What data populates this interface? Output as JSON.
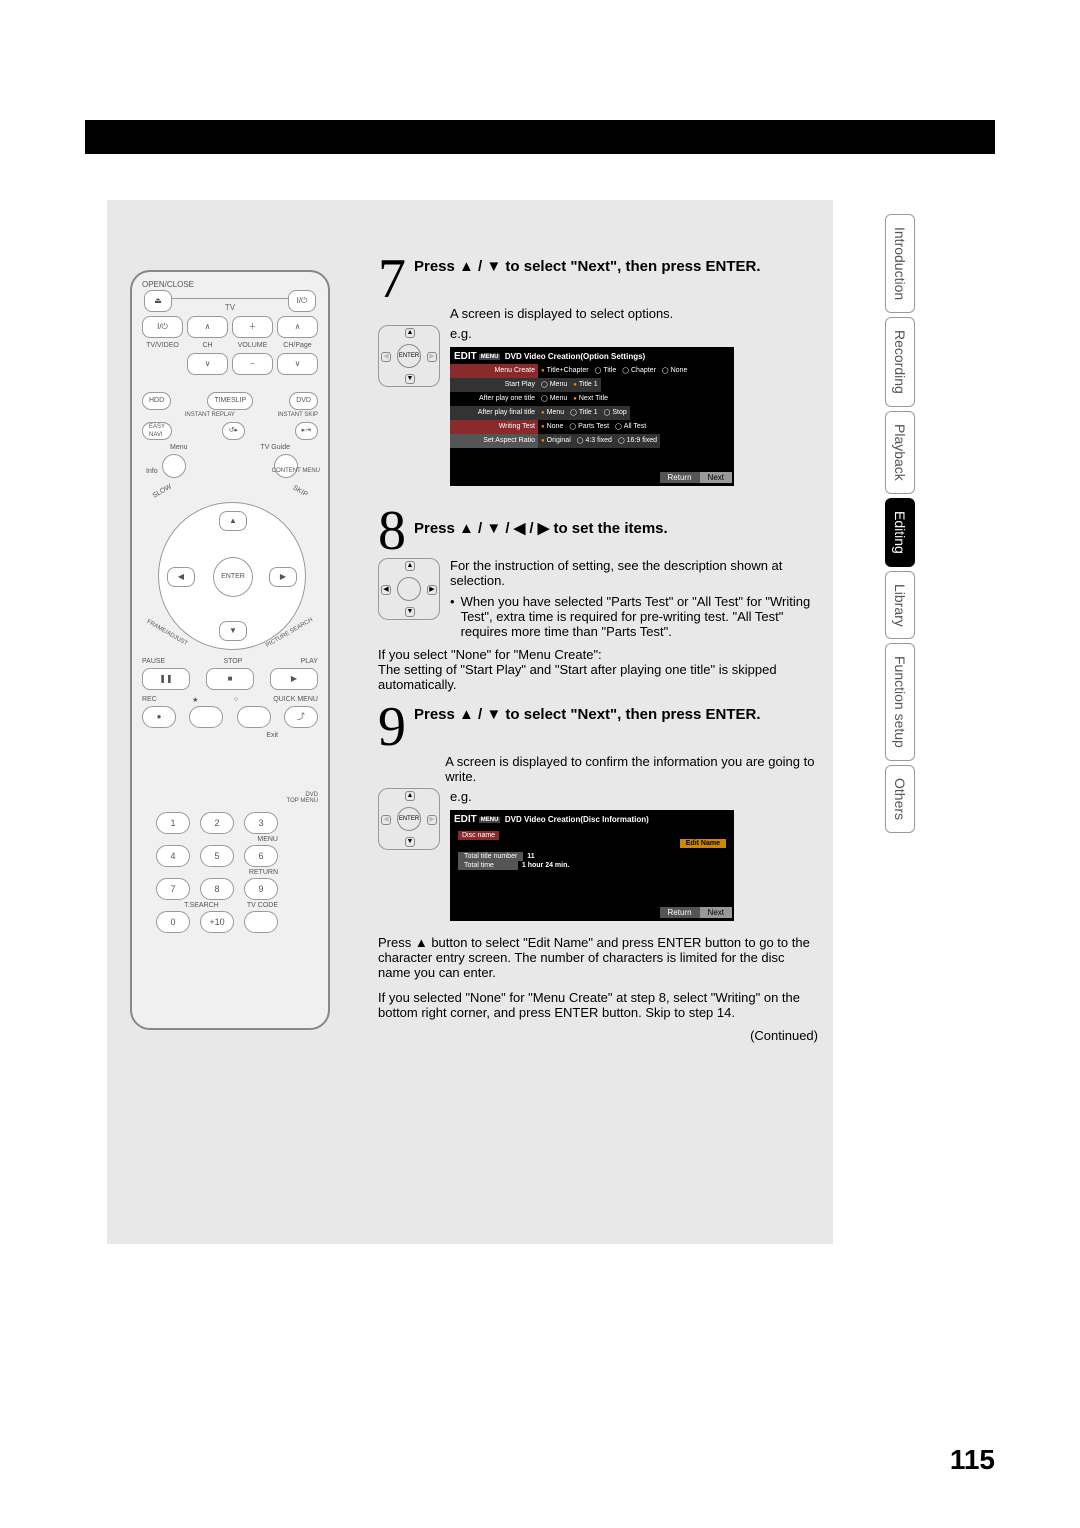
{
  "page_number": "115",
  "continued": "(Continued)",
  "tabs": [
    "Introduction",
    "Recording",
    "Playback",
    "Editing",
    "Library",
    "Function setup",
    "Others"
  ],
  "active_tab": "Editing",
  "remote": {
    "open_close": "OPEN/CLOSE",
    "tv": "TV",
    "tvvideo": "TV/VIDEO",
    "ch": "CH",
    "volume": "VOLUME",
    "chpage": "CH/Page",
    "hdd": "HDD",
    "timeslip": "TIMESLIP",
    "dvd": "DVD",
    "instant_replay": "INSTANT REPLAY",
    "instant_skip": "INSTANT SKIP",
    "easy": "EASY\nNAVI",
    "menu": "Menu",
    "tvguide": "TV Guide",
    "info": "Info",
    "content_menu": "CONTENT MENU",
    "slow": "SLOW",
    "skip": "SKIP",
    "enter": "ENTER",
    "frame": "FRAME/ADJUST",
    "picture": "PICTURE SEARCH",
    "pause": "PAUSE",
    "stop": "STOP",
    "play": "PLAY",
    "rec": "REC",
    "quickmenu": "QUICK MENU",
    "exit": "Exit",
    "dvdtop": "DVD\nTOP MENU",
    "menub": "MENU",
    "return": "RETURN",
    "tsearch": "T.SEARCH",
    "tvcode": "TV CODE",
    "plus10": "+10"
  },
  "step7": {
    "heading": "Press ▲ / ▼ to select \"Next\", then press ENTER.",
    "body": "A screen is displayed to select options.",
    "eg": "e.g.",
    "s_title": "DVD Video Creation(Option Settings)",
    "s_edit": "EDIT",
    "s_menu": "MENU",
    "r1_l": "Menu Create",
    "r1": [
      "Title+Chapter",
      "Title",
      "Chapter",
      "None"
    ],
    "r2_l": "Start Play",
    "r2": [
      "Menu",
      "Title 1"
    ],
    "r3_l": "After play one title",
    "r3": [
      "Menu",
      "Next Title"
    ],
    "r4_l": "After play final title",
    "r4": [
      "Menu",
      "Title 1",
      "Stop"
    ],
    "r5_l": "Writing Test",
    "r5": [
      "None",
      "Parts Test",
      "All Test"
    ],
    "r6_l": "Set Aspect Ratio",
    "r6": [
      "Original",
      "4:3 fixed",
      "16:9 fixed"
    ],
    "return": "Return",
    "next": "Next"
  },
  "step8": {
    "heading": "Press ▲ / ▼ / ◀ / ▶ to set the items.",
    "body1": "For the instruction of setting, see the description shown at selection.",
    "bullet": "When you have selected \"Parts Test\" or \"All Test\" for \"Writing Test\", extra time is required for pre-writing test. \"All Test\" requires more time than \"Parts Test\".",
    "body2": "If you select \"None\" for \"Menu Create\":\nThe setting of \"Start Play\" and \"Start after playing one title\" is skipped automatically."
  },
  "step9": {
    "heading": "Press ▲ / ▼ to select \"Next\", then press ENTER.",
    "body": "A screen is displayed to confirm the information you are going to write.",
    "eg": "e.g.",
    "s_title": "DVD Video Creation(Disc Information)",
    "s_edit": "EDIT",
    "s_menu": "MENU",
    "discname": "Disc name",
    "editname": "Edit Name",
    "total_num_l": "Total title number",
    "total_num": "11",
    "total_time_l": "Total time",
    "total_time": "1 hour 24 min.",
    "return": "Return",
    "next": "Next",
    "para1": "Press ▲ button to select \"Edit Name\" and press ENTER button to go to the character entry screen. The number of characters is limited for the disc name you can enter.",
    "para2": "If you selected \"None\" for \"Menu Create\" at step 8, select \"Writing\" on the bottom right corner, and press ENTER button. Skip to step 14."
  }
}
